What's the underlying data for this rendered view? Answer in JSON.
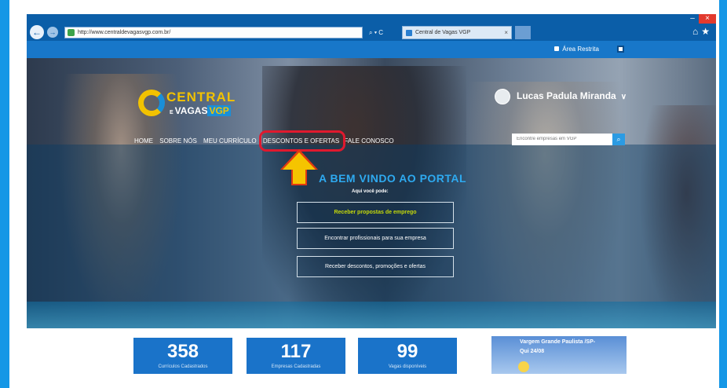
{
  "browser": {
    "url": "http://www.centraldevagasvgp.com.br/",
    "address_tools": "⌕ ▾ C",
    "tab_title": "Central de Vagas VGP",
    "tab_close": "×",
    "window_min": "–",
    "window_close": "×",
    "back_glyph": "←",
    "forward_glyph": "→",
    "home_star": "⌂★"
  },
  "topbar": {
    "area_restrita": "Área Restrita"
  },
  "header": {
    "logo_central": "CENTRAL",
    "logo_e": "E",
    "logo_vagas": "VAGAS",
    "logo_vgp": "VGP",
    "user_name": "Lucas Padula Miranda",
    "user_caret": "∨"
  },
  "menu": {
    "items": [
      "HOME",
      "SOBRE NÓS",
      "MEU CURRÍCULO",
      "DESCONTOS E OFERTAS",
      "FALE CONOSCO"
    ]
  },
  "search": {
    "placeholder": "Encontre empresas em VGP",
    "button_glyph": "⌕"
  },
  "hero": {
    "welcome": "A BEM VINDO AO PORTAL",
    "subtitle": "Aqui você pode:",
    "options": [
      "Receber propostas de emprego",
      "Encontrar profissionais para sua empresa",
      "Receber descontos, promoções e ofertas"
    ]
  },
  "stats": [
    {
      "value": "358",
      "label": "Currículos Cadastrados"
    },
    {
      "value": "117",
      "label": "Empresas Cadastradas"
    },
    {
      "value": "99",
      "label": "Vagas disponíveis"
    }
  ],
  "weather": {
    "city": "Vargem Grande Paulista /SP-",
    "date": "Qui 24/08"
  },
  "colors": {
    "brand_blue": "#1877c9",
    "highlight_red": "#e0192e",
    "arrow_yellow": "#f5c400"
  }
}
